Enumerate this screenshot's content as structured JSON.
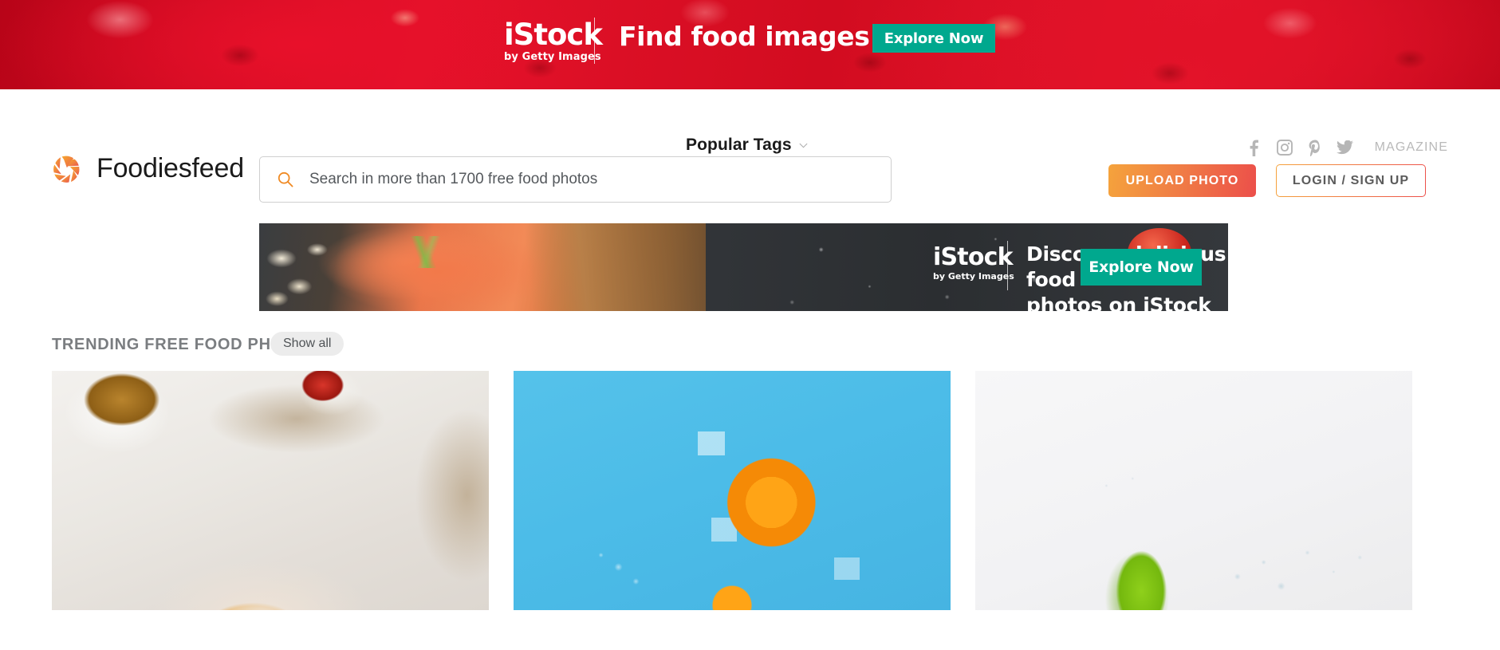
{
  "top_banner": {
    "brand": "iStock",
    "brand_sub": "by Getty Images",
    "headline": "Find food images",
    "cta_label": "Explore Now",
    "cta_color": "#00a88e",
    "background_color": "#d20c20"
  },
  "utility_nav": {
    "popular_tags_label": "Popular Tags",
    "chevron_icon": "chevron-down-icon",
    "social": [
      {
        "name": "facebook-icon",
        "label": "f"
      },
      {
        "name": "instagram-icon",
        "label": ""
      },
      {
        "name": "pinterest-icon",
        "label": "P"
      },
      {
        "name": "twitter-icon",
        "label": ""
      }
    ],
    "magazine_label": "MAGAZINE"
  },
  "header": {
    "logo_icon": "aperture-logo-icon",
    "site_name": "Foodiesfeed",
    "search": {
      "icon": "search-icon",
      "placeholder": "Search in more than 1700 free food photos",
      "value": ""
    },
    "upload_label": "UPLOAD PHOTO",
    "login_label": "LOGIN / SIGN UP",
    "accent_start": "#f5a33c",
    "accent_end": "#ec4f4a"
  },
  "banner2": {
    "brand": "iStock",
    "brand_sub": "by Getty Images",
    "headline_line1": "Discover delicious food",
    "headline_line2": "photos on iStock",
    "cta_label": "Explore Now",
    "cta_color": "#00a88e"
  },
  "trending": {
    "title": "TRENDING FREE FOOD PHOTOS",
    "show_all_label": "Show all",
    "photos": [
      {
        "name": "photo-card-breakfast",
        "alt": "Fried egg toast with tea cup and cherry tomatoes on white wood"
      },
      {
        "name": "photo-card-orange",
        "alt": "Orange slice with ice cubes on blue background"
      },
      {
        "name": "photo-card-lime",
        "alt": "Lime wedge with water splash on white background"
      }
    ]
  }
}
